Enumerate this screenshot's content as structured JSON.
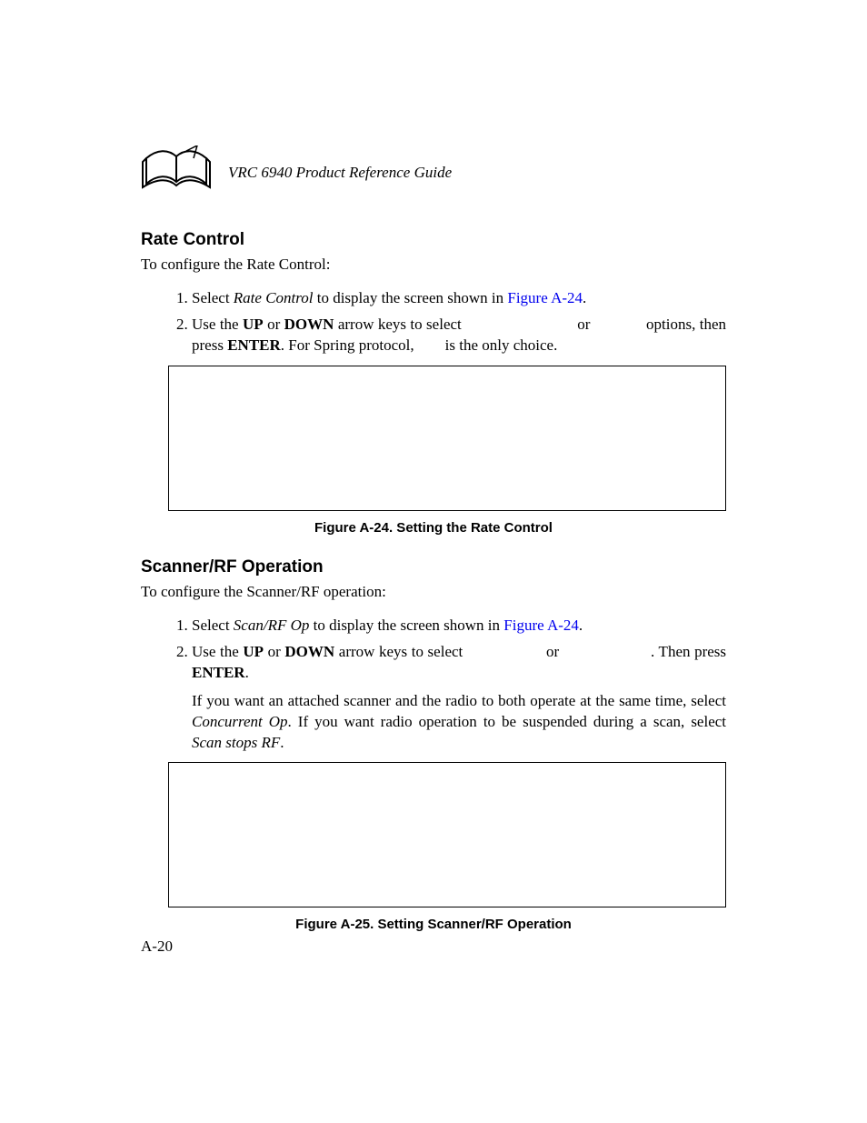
{
  "header": {
    "doc_title": "VRC 6940 Product Reference Guide"
  },
  "section1": {
    "heading": "Rate Control",
    "intro": "To configure the Rate Control:",
    "li1": {
      "a": "Select ",
      "b": "Rate Control",
      "c": " to display the screen shown in ",
      "d": "Figure A-24",
      "e": "."
    },
    "li2": {
      "a": "Use the ",
      "b": "UP",
      "c": " or ",
      "d": "DOWN",
      "e": " arrow keys to select ",
      "f": " or ",
      "g": " options, then press ",
      "h": "ENTER",
      "i": ". For Spring protocol, ",
      "j": " is the only choice."
    },
    "caption": "Figure A-24.  Setting the Rate Control"
  },
  "section2": {
    "heading": "Scanner/RF Operation",
    "intro": "To configure the Scanner/RF operation:",
    "li1": {
      "a": "Select ",
      "b": "Scan/RF Op",
      "c": " to display the screen shown in ",
      "d": "Figure A-24",
      "e": "."
    },
    "li2": {
      "a": "Use the ",
      "b": "UP",
      "c": " or ",
      "d": "DOWN",
      "e": " arrow keys to select ",
      "f": " or ",
      "g": ". Then press ",
      "h": "ENTER",
      "i": "."
    },
    "li2_note": {
      "a": "If you want an attached scanner and the radio to both operate at the same time, select ",
      "b": "Concurrent Op",
      "c": ". If you want radio operation to be suspended during a scan, select ",
      "d": "Scan stops RF",
      "e": "."
    },
    "caption": "Figure A-25.  Setting Scanner/RF Operation"
  },
  "page_number": "A-20"
}
